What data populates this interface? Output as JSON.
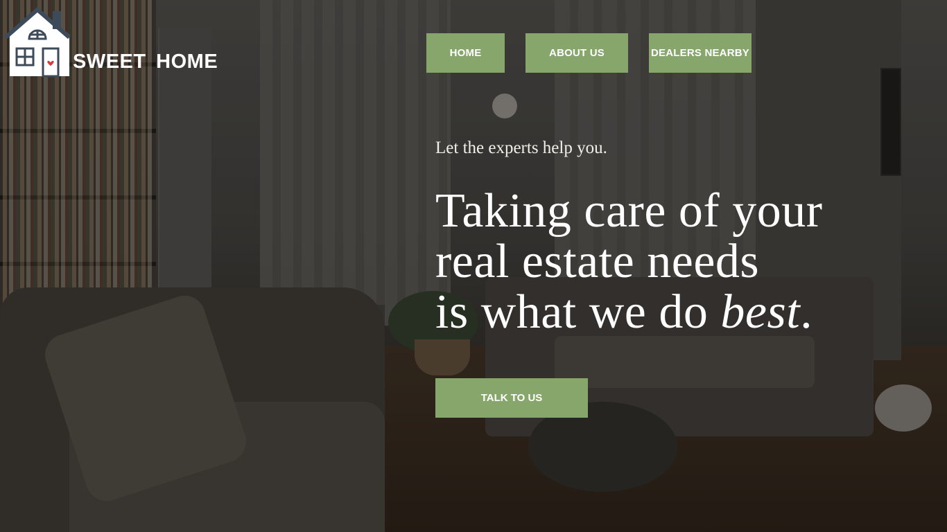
{
  "brand": {
    "name": "SWEET  HOME",
    "logo_icon": "house-icon",
    "accent_color": "#86a66c",
    "heart_color": "#d83a3a"
  },
  "nav": {
    "items": [
      {
        "label": "HOME"
      },
      {
        "label": "ABOUT US"
      },
      {
        "label": "DEALERS NEARBY"
      }
    ]
  },
  "hero": {
    "tagline": "Let the experts help you.",
    "headline_line1": "Taking care of your",
    "headline_line2": "real estate needs",
    "headline_line3_prefix": "is what we do ",
    "headline_line3_emphasis": "best",
    "headline_line3_suffix": ".",
    "cta_label": "TALK TO US"
  }
}
